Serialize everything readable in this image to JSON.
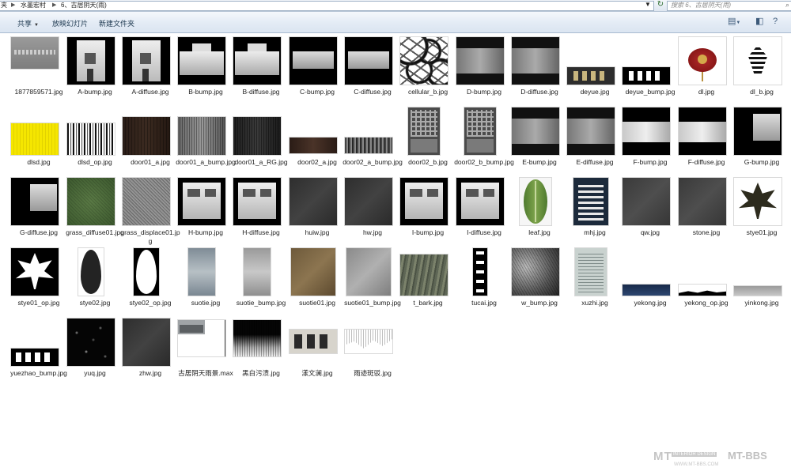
{
  "address_bar": {
    "crumbs": [
      "夹",
      "水墨宏村",
      "6、古居阴天(雨)"
    ],
    "search_placeholder": "搜索 6、古居阴天(雨)"
  },
  "toolbar": {
    "share_label": "共享",
    "slideshow_label": "放映幻灯片",
    "new_folder_label": "新建文件夹"
  },
  "files": [
    {
      "name": "1877859571.jpg",
      "thumb": "texture-gray-plaque"
    },
    {
      "name": "A-bump.jpg",
      "thumb": "house-facade"
    },
    {
      "name": "A-diffuse.jpg",
      "thumb": "house-facade"
    },
    {
      "name": "B-bump.jpg",
      "thumb": "wide-wall"
    },
    {
      "name": "B-diffuse.jpg",
      "thumb": "wide-wall"
    },
    {
      "name": "C-bump.jpg",
      "thumb": "wall-strip"
    },
    {
      "name": "C-diffuse.jpg",
      "thumb": "wall-strip"
    },
    {
      "name": "cellular_b.jpg",
      "thumb": "cellular"
    },
    {
      "name": "D-bump.jpg",
      "thumb": "dark-wall"
    },
    {
      "name": "D-diffuse.jpg",
      "thumb": "dark-wall"
    },
    {
      "name": "deyue.jpg",
      "thumb": "plaque-dark"
    },
    {
      "name": "deyue_bump.jpg",
      "thumb": "plaque-black"
    },
    {
      "name": "dl.jpg",
      "thumb": "lantern"
    },
    {
      "name": "dl_b.jpg",
      "thumb": "fu-char"
    },
    {
      "name": "dlsd.jpg",
      "thumb": "yellow"
    },
    {
      "name": "dlsd_op.jpg",
      "thumb": "stripes"
    },
    {
      "name": "door01_a.jpg",
      "thumb": "dark-wood"
    },
    {
      "name": "door01_a_bump.jpg",
      "thumb": "gray-wood"
    },
    {
      "name": "door01_a_RG.jpg",
      "thumb": "dark-wood2"
    },
    {
      "name": "door02_a.jpg",
      "thumb": "wood-strip"
    },
    {
      "name": "door02_a_bump.jpg",
      "thumb": "wood-strip-gray"
    },
    {
      "name": "door02_b.jpg",
      "thumb": "lattice-door"
    },
    {
      "name": "door02_b_bump.jpg",
      "thumb": "lattice-door"
    },
    {
      "name": "E-bump.jpg",
      "thumb": "dark-wall"
    },
    {
      "name": "E-diffuse.jpg",
      "thumb": "dark-wall"
    },
    {
      "name": "F-bump.jpg",
      "thumb": "wall-strip2"
    },
    {
      "name": "F-diffuse.jpg",
      "thumb": "wall-strip2"
    },
    {
      "name": "G-bump.jpg",
      "thumb": "corner-wall"
    },
    {
      "name": "G-diffuse.jpg",
      "thumb": "corner-wall"
    },
    {
      "name": "grass_diffuse01.jpg",
      "thumb": "grass"
    },
    {
      "name": "grass_displace01.jpg",
      "thumb": "noise"
    },
    {
      "name": "H-bump.jpg",
      "thumb": "house-facade2"
    },
    {
      "name": "H-diffuse.jpg",
      "thumb": "house-facade2"
    },
    {
      "name": "huiw.jpg",
      "thumb": "dark-gray"
    },
    {
      "name": "hw.jpg",
      "thumb": "dark-gray"
    },
    {
      "name": "I-bump.jpg",
      "thumb": "house-facade2"
    },
    {
      "name": "I-diffuse.jpg",
      "thumb": "house-facade2"
    },
    {
      "name": "leaf.jpg",
      "thumb": "leaf"
    },
    {
      "name": "mhj.jpg",
      "thumb": "calligraphy-blue"
    },
    {
      "name": "qw.jpg",
      "thumb": "dark-gray2"
    },
    {
      "name": "stone.jpg",
      "thumb": "dark-gray2"
    },
    {
      "name": "stye01.jpg",
      "thumb": "maple"
    },
    {
      "name": "stye01_op.jpg",
      "thumb": "maple-op"
    },
    {
      "name": "stye02.jpg",
      "thumb": "leaf-bw"
    },
    {
      "name": "stye02_op.jpg",
      "thumb": "leaf-op"
    },
    {
      "name": "suotie.jpg",
      "thumb": "suotie"
    },
    {
      "name": "suotie_bump.jpg",
      "thumb": "suotie-gray"
    },
    {
      "name": "suotie01.jpg",
      "thumb": "brown-stone"
    },
    {
      "name": "suotie01_bump.jpg",
      "thumb": "gray-stone"
    },
    {
      "name": "t_bark.jpg",
      "thumb": "bark"
    },
    {
      "name": "tucai.jpg",
      "thumb": "vertical-plaque"
    },
    {
      "name": "w_bump.jpg",
      "thumb": "grunge"
    },
    {
      "name": "xuzhi.jpg",
      "thumb": "paper"
    },
    {
      "name": "yekong.jpg",
      "thumb": "sky-strip"
    },
    {
      "name": "yekong_op.jpg",
      "thumb": "sky-op"
    },
    {
      "name": "yinkong.jpg",
      "thumb": "gray-strip"
    },
    {
      "name": "yuezhao_bump.jpg",
      "thumb": "plaque-black2"
    },
    {
      "name": "yuq.jpg",
      "thumb": "starfield"
    },
    {
      "name": "zhw.jpg",
      "thumb": "dark-gray"
    },
    {
      "name": "古居阴天雨景.max",
      "thumb": "max-file"
    },
    {
      "name": "黑白污渍.jpg",
      "thumb": "stain-bw"
    },
    {
      "name": "漾文澜.jpg",
      "thumb": "plaque-light"
    },
    {
      "name": "雨迹斑驳.jpg",
      "thumb": "rain-drips"
    }
  ],
  "watermark": {
    "brand_left": "MT",
    "brand_right": "MT-BBS",
    "badge": "INTERIOR DESIGN",
    "url": "WWW.MT-BBS.COM"
  }
}
